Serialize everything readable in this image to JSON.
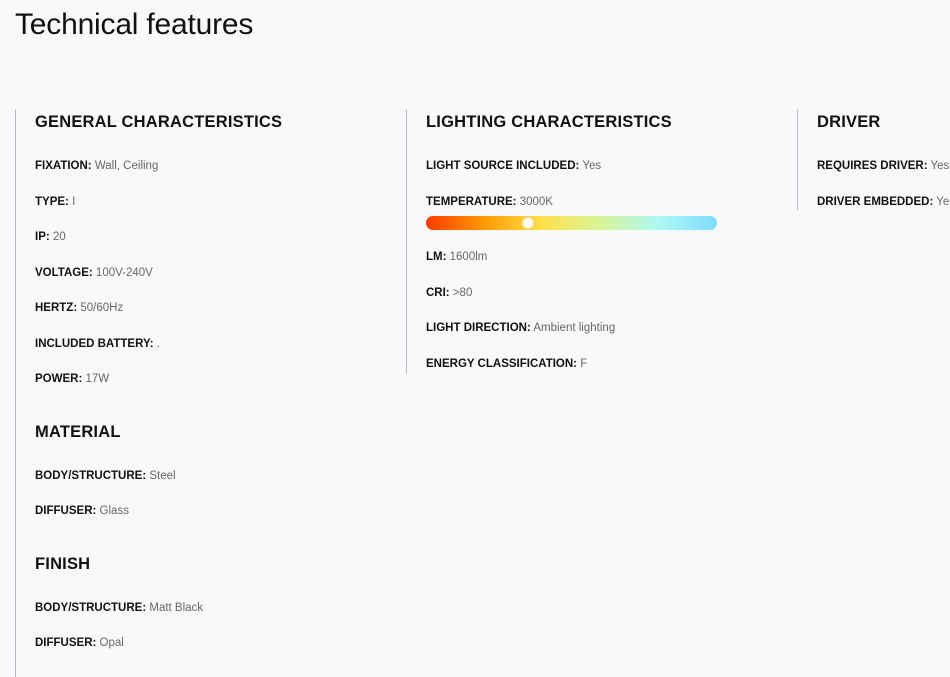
{
  "page": {
    "title": "Technical features"
  },
  "general": {
    "title": "GENERAL CHARACTERISTICS",
    "items": [
      {
        "key": "FIXATION:",
        "value": "Wall, Ceiling"
      },
      {
        "key": "TYPE:",
        "value": "I"
      },
      {
        "key": "IP:",
        "value": "20"
      },
      {
        "key": "VOLTAGE:",
        "value": "100V-240V"
      },
      {
        "key": "HERTZ:",
        "value": "50/60Hz"
      },
      {
        "key": "INCLUDED BATTERY:",
        "value": "."
      },
      {
        "key": "POWER:",
        "value": "17W"
      }
    ]
  },
  "material": {
    "title": "MATERIAL",
    "items": [
      {
        "key": "BODY/STRUCTURE:",
        "value": "Steel"
      },
      {
        "key": "DIFFUSER:",
        "value": "Glass"
      }
    ]
  },
  "finish": {
    "title": "FINISH",
    "items": [
      {
        "key": "BODY/STRUCTURE:",
        "value": "Matt Black"
      },
      {
        "key": "DIFFUSER:",
        "value": "Opal"
      }
    ]
  },
  "lighting": {
    "title": "LIGHTING CHARACTERISTICS",
    "items": [
      {
        "key": "LIGHT SOURCE INCLUDED:",
        "value": "Yes"
      },
      {
        "key": "TEMPERATURE:",
        "value": "3000K"
      },
      {
        "key": "LM:",
        "value": "1600lm"
      },
      {
        "key": "CRI:",
        "value": ">80"
      },
      {
        "key": "LIGHT DIRECTION:",
        "value": "Ambient lighting"
      },
      {
        "key": "ENERGY CLASSIFICATION:",
        "value": "F"
      }
    ],
    "temperature_scale": {
      "position_fraction": 0.35,
      "colors": [
        "#ff3a00",
        "#ff9a00",
        "#ffe14a",
        "#d8f59a",
        "#aef9f4",
        "#7fdcff"
      ]
    }
  },
  "driver": {
    "title": "DRIVER",
    "items": [
      {
        "key": "REQUIRES DRIVER:",
        "value": "Yes"
      },
      {
        "key": "DRIVER EMBEDDED:",
        "value": "Yes"
      }
    ]
  }
}
